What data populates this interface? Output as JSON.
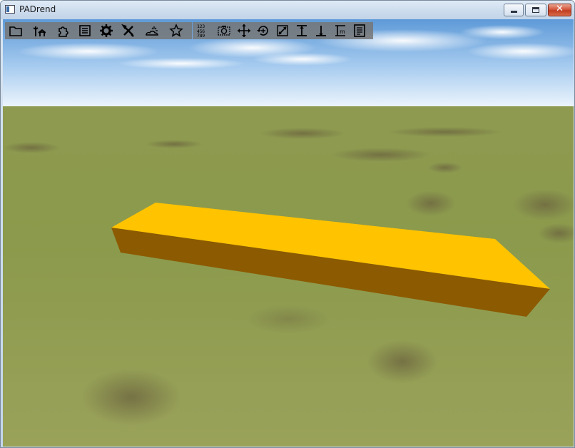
{
  "window": {
    "title": "PADrend",
    "controls": {
      "minimize": "minimize",
      "maximize": "maximize",
      "close": "✕"
    }
  },
  "toolbar_left": [
    {
      "name": "folder-icon"
    },
    {
      "name": "scene-tree-icon"
    },
    {
      "name": "plugin-puzzle-icon"
    },
    {
      "name": "list-document-icon"
    },
    {
      "name": "gear-icon"
    },
    {
      "name": "tools-icon"
    },
    {
      "name": "sky-sun-icon"
    },
    {
      "name": "star-icon"
    }
  ],
  "toolbar_right": [
    {
      "name": "number-grid-icon",
      "rows": [
        "123",
        "456",
        "789"
      ]
    },
    {
      "name": "camera-view-icon"
    },
    {
      "name": "move-arrows-icon"
    },
    {
      "name": "rotate-icon"
    },
    {
      "name": "scale-icon"
    },
    {
      "name": "snap-top-icon"
    },
    {
      "name": "anchor-icon"
    },
    {
      "name": "measure-m-icon",
      "label": "m"
    },
    {
      "name": "properties-icon"
    }
  ],
  "colors": {
    "box_top": "#ffc300",
    "box_side": "#8c5a00",
    "sky_top": "#5e9ad8",
    "grass": "#8b9a4c"
  }
}
